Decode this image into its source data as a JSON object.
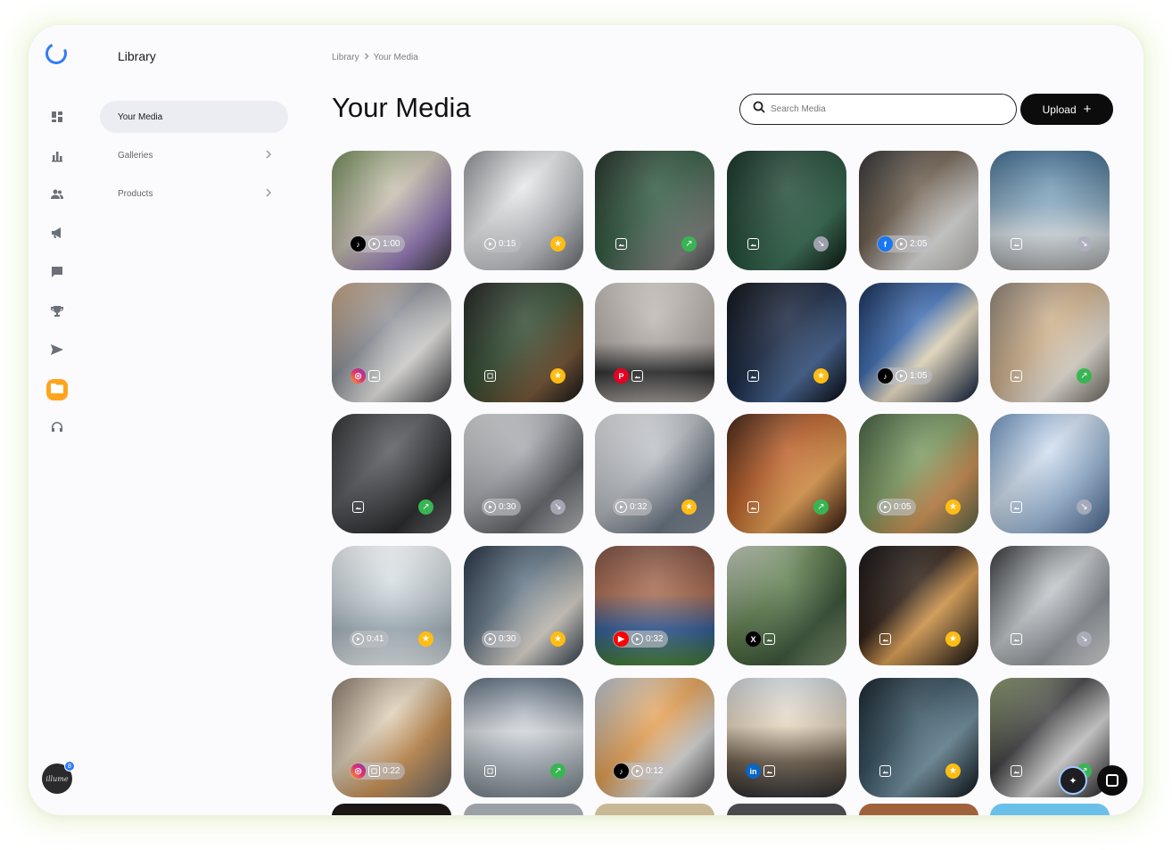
{
  "app": {
    "panel_title": "Library"
  },
  "rail": {
    "items": [
      {
        "name": "dashboard-icon"
      },
      {
        "name": "bar-chart-icon"
      },
      {
        "name": "users-icon"
      },
      {
        "name": "megaphone-icon"
      },
      {
        "name": "chat-icon"
      },
      {
        "name": "trophy-icon"
      },
      {
        "name": "send-icon"
      },
      {
        "name": "folder-icon",
        "active": true
      },
      {
        "name": "headset-icon"
      }
    ],
    "avatar_label": "illume",
    "avatar_badge": "8"
  },
  "sidebar": {
    "items": [
      {
        "label": "Your Media",
        "active": true
      },
      {
        "label": "Galleries"
      },
      {
        "label": "Products"
      }
    ]
  },
  "header": {
    "breadcrumb": [
      "Library",
      "Your Media"
    ],
    "title": "Your Media",
    "search_placeholder": "Search Media",
    "upload_label": "Upload"
  },
  "colors": {
    "accent": "#ffa41c",
    "star": "#ffbd14",
    "success": "#38b552",
    "link_blue": "#2f7cf6"
  },
  "media": [
    {
      "bg": "linear-gradient(135deg,#6f8a55,#c9c2b2 45%,#8a6fb0 75%,#3a3a3a)",
      "social": "tiktok",
      "type": "video",
      "duration": "1:00",
      "status": ""
    },
    {
      "bg": "linear-gradient(135deg,#8d8f94,#e7e8ea 40%,#b9bbc0 70%,#6d6f74)",
      "social": "",
      "type": "video",
      "duration": "0:15",
      "status": "star"
    },
    {
      "bg": "linear-gradient(135deg,#1d2b23,#2f5a3f 45%,#7a7c7a 80%,#4a4b4c)",
      "social": "",
      "type": "image",
      "duration": "",
      "status": "up"
    },
    {
      "bg": "linear-gradient(135deg,#0f2a20,#1f4a36 45%,#2c6248 70%,#0b1711)",
      "social": "",
      "type": "image",
      "duration": "",
      "status": "down"
    },
    {
      "bg": "linear-gradient(135deg,#2b2c2e,#6a5a4a 40%,#d8d8d6 70%,#bdbcba)",
      "social": "facebook",
      "type": "video",
      "duration": "2:05",
      "status": ""
    },
    {
      "bg": "linear-gradient(180deg,#3d6a8e,#87aac2 45%,#d7e1e7 70%,#a7a9ab)",
      "social": "",
      "type": "image",
      "duration": "",
      "status": "down"
    },
    {
      "bg": "linear-gradient(135deg,#caa581,#8b8f97 40%,#e5e4e2 65%,#3c3d40)",
      "social": "instagram",
      "type": "image",
      "duration": "",
      "status": ""
    },
    {
      "bg": "linear-gradient(135deg,#1b1c1a,#2f4a2f 45%,#6b4a2a 75%,#141414)",
      "social": "",
      "type": "carousel",
      "duration": "",
      "status": "star"
    },
    {
      "bg": "linear-gradient(180deg,#c9c3bd,#b3aca6 50%,#2a2a2c 75%,#9a938d)",
      "social": "pinterest",
      "type": "image",
      "duration": "",
      "status": ""
    },
    {
      "bg": "linear-gradient(135deg,#05070d,#142440 45%,#3a5a8a 70%,#05070d)",
      "social": "",
      "type": "image",
      "duration": "",
      "status": "star"
    },
    {
      "bg": "linear-gradient(135deg,#0d2550,#3a6ab0 40%,#f3e6c8 60%,#0a1a3a)",
      "social": "tiktok",
      "type": "video",
      "duration": "1:05",
      "status": ""
    },
    {
      "bg": "linear-gradient(135deg,#8c8073,#d1b28c 45%,#e8e1d6 70%,#6a6a62)",
      "social": "",
      "type": "image",
      "duration": "",
      "status": "up"
    },
    {
      "bg": "linear-gradient(135deg,#2a2b2d,#52555a 40%,#1a1b1d 75%,#6d6e70)",
      "social": "",
      "type": "image",
      "duration": "",
      "status": "up"
    },
    {
      "bg": "linear-gradient(135deg,#d6d8da,#a3a6ab 40%,#55585d 70%,#c5c7c9)",
      "social": "",
      "type": "video",
      "duration": "0:30",
      "status": "down"
    },
    {
      "bg": "linear-gradient(135deg,#dfe1e4,#b7bbc1 45%,#5f6c7a 75%,#8b95a0)",
      "social": "",
      "type": "video",
      "duration": "0:32",
      "status": "star"
    },
    {
      "bg": "linear-gradient(135deg,#3a1b0e,#b85a22 40%,#e49a4a 65%,#2a120a)",
      "social": "",
      "type": "image",
      "duration": "",
      "status": "up"
    },
    {
      "bg": "linear-gradient(135deg,#3d5a3a,#7c9a5f 45%,#c98a4a 70%,#5a6a4a)",
      "social": "",
      "type": "video",
      "duration": "0:05",
      "status": "star"
    },
    {
      "bg": "linear-gradient(135deg,#6b92c2,#cfdff0 40%,#9ab8d8 65%,#4a6a92)",
      "social": "",
      "type": "image",
      "duration": "",
      "status": "down"
    },
    {
      "bg": "linear-gradient(180deg,#eef2f4,#c7d2d8 45%,#a7b6bf 70%,#dfe6ea)",
      "social": "",
      "type": "video",
      "duration": "0:41",
      "status": "star"
    },
    {
      "bg": "linear-gradient(135deg,#1c2a3a,#5c6f80 40%,#d7d2c8 70%,#2f3f4f)",
      "social": "",
      "type": "video",
      "duration": "0:30",
      "status": "star"
    },
    {
      "bg": "linear-gradient(180deg,#7a4a3a,#a9684c 40%,#2d5a9a 70%,#3f7a2f)",
      "social": "youtube",
      "type": "video",
      "duration": "0:32",
      "status": ""
    },
    {
      "bg": "linear-gradient(135deg,#c8d0c0,#5a7a4a 40%,#2e4a2c 70%,#8a9a7a)",
      "social": "x",
      "type": "image",
      "duration": "",
      "status": ""
    },
    {
      "bg": "linear-gradient(135deg,#0a0a0c,#2a1a10 40%,#e0a050 60%,#0a0a0c)",
      "social": "",
      "type": "image",
      "duration": "",
      "status": "star"
    },
    {
      "bg": "linear-gradient(135deg,#2a2d30,#c4c8cc 45%,#8a8e93 70%,#e6e8ea)",
      "social": "",
      "type": "image",
      "duration": "",
      "status": "down"
    },
    {
      "bg": "linear-gradient(135deg,#8a7a6a,#e0d0b8 40%,#c58a4a 65%,#6a6a6a)",
      "social": "instagram",
      "type": "carousel",
      "duration": "0:22",
      "status": ""
    },
    {
      "bg": "linear-gradient(180deg,#5a6a7a,#d8dde2 45%,#aab4bc 70%,#7a858e)",
      "social": "",
      "type": "carousel",
      "duration": "",
      "status": "up"
    },
    {
      "bg": "linear-gradient(135deg,#b8c8d8,#e8a050 45%,#d8d8d8 70%,#4a4a4c)",
      "social": "tiktok",
      "type": "video",
      "duration": "0:12",
      "status": ""
    },
    {
      "bg": "linear-gradient(180deg,#cfd6dc,#e8d8c0 40%,#6a5a48 70%,#2a2a2c)",
      "social": "linkedin",
      "type": "image",
      "duration": "",
      "status": ""
    },
    {
      "bg": "linear-gradient(135deg,#0e1a22,#2e4a5a 40%,#6a8a9a 65%,#0a1218)",
      "social": "",
      "type": "image",
      "duration": "",
      "status": "star"
    },
    {
      "bg": "linear-gradient(135deg,#8a9a6a,#3a3a3c 40%,#d8d8d8 65%,#1a1a1c)",
      "social": "",
      "type": "image",
      "duration": "",
      "status": "up"
    }
  ],
  "peek_row": [
    {
      "bg": "#1a1614"
    },
    {
      "bg": "#9aa0a6"
    },
    {
      "bg": "#c8b896"
    },
    {
      "bg": "#4a4a4c"
    },
    {
      "bg": "#a0623a"
    },
    {
      "bg": "#6ac0e8"
    }
  ]
}
